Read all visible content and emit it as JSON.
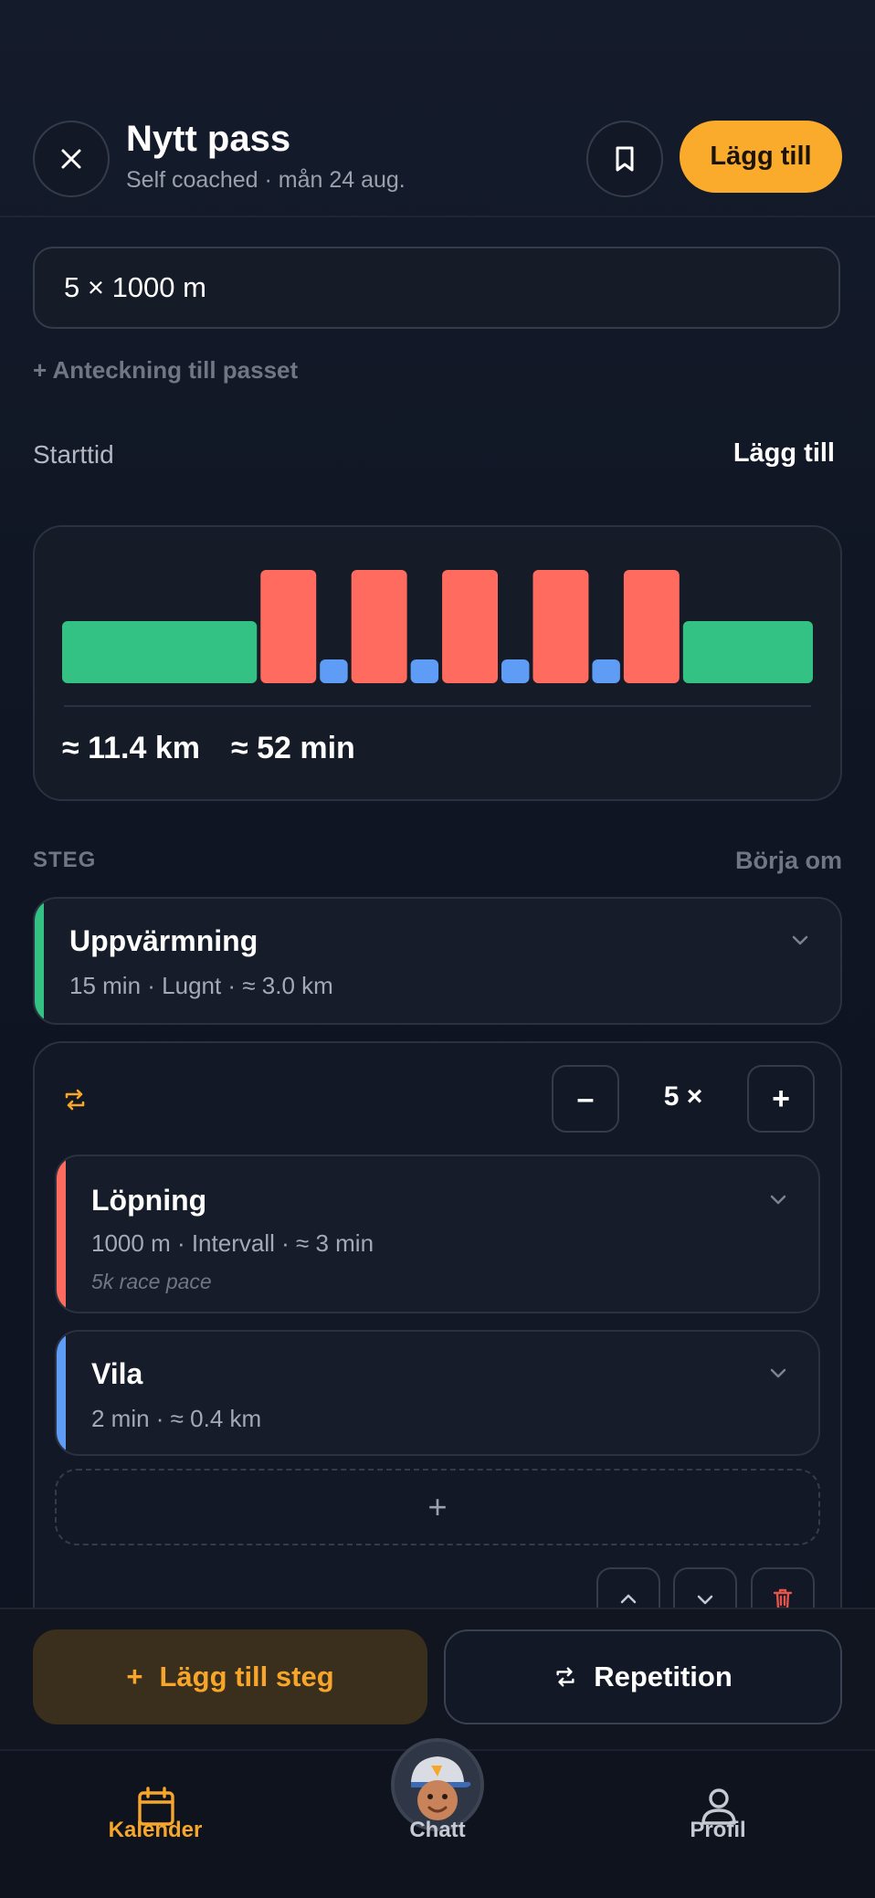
{
  "header": {
    "title": "Nytt pass",
    "subtitle": "Self coached · mån 24 aug.",
    "add_label": "Lägg till"
  },
  "workout_name": "5 × 1000 m",
  "note_link": "+ Anteckning till passet",
  "start_time": {
    "label": "Starttid",
    "action": "Lägg till"
  },
  "summary": {
    "distance": "≈ 11.4 km",
    "duration": "≈ 52 min"
  },
  "chart_data": {
    "type": "bar",
    "segments": [
      {
        "kind": "warmup",
        "minutes": 15,
        "intensity": "low"
      },
      {
        "kind": "interval",
        "minutes": 3,
        "intensity": "high"
      },
      {
        "kind": "rest",
        "minutes": 2,
        "intensity": "rest"
      },
      {
        "kind": "interval",
        "minutes": 3,
        "intensity": "high"
      },
      {
        "kind": "rest",
        "minutes": 2,
        "intensity": "rest"
      },
      {
        "kind": "interval",
        "minutes": 3,
        "intensity": "high"
      },
      {
        "kind": "rest",
        "minutes": 2,
        "intensity": "rest"
      },
      {
        "kind": "interval",
        "minutes": 3,
        "intensity": "high"
      },
      {
        "kind": "rest",
        "minutes": 2,
        "intensity": "rest"
      },
      {
        "kind": "interval",
        "minutes": 3,
        "intensity": "high"
      },
      {
        "kind": "cooldown",
        "minutes": 15,
        "intensity": "low"
      }
    ],
    "colors": {
      "low": "#34c184",
      "high": "#ff6b5e",
      "rest": "#5f9cf5"
    }
  },
  "steps": {
    "label": "STEG",
    "reset": "Börja om",
    "warmup": {
      "title": "Uppvärmning",
      "meta": "15 min · Lugnt · ≈ 3.0 km",
      "color": "#34c184"
    },
    "repeat": {
      "count": "5 ×",
      "minus": "–",
      "plus": "+",
      "run": {
        "title": "Löpning",
        "meta": "1000 m · Intervall · ≈ 3 min",
        "note": "5k race pace",
        "color": "#ff6b5e"
      },
      "rest": {
        "title": "Vila",
        "meta": "2 min · ≈ 0.4 km",
        "color": "#5f9cf5"
      },
      "add": "+"
    }
  },
  "actions": {
    "add_step": "Lägg till steg",
    "add_step_icon": "+",
    "repeat": "Repetition"
  },
  "tabs": [
    {
      "label": "Kalender",
      "icon": "calendar-icon",
      "active": true
    },
    {
      "label": "Chatt",
      "icon": "avatar",
      "active": false
    },
    {
      "label": "Profil",
      "icon": "person-icon",
      "active": false
    }
  ],
  "accent": "#fbab2b"
}
